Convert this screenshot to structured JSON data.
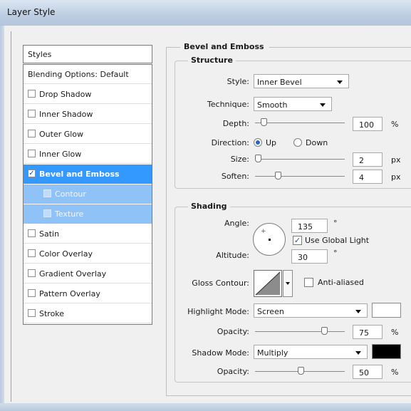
{
  "window": {
    "title": "Layer Style"
  },
  "styles_panel": {
    "header": "Styles",
    "items": [
      {
        "label": "Blending Options: Default",
        "checkbox": false,
        "checked": false
      },
      {
        "label": "Drop Shadow",
        "checkbox": true,
        "checked": false
      },
      {
        "label": "Inner Shadow",
        "checkbox": true,
        "checked": false
      },
      {
        "label": "Outer Glow",
        "checkbox": true,
        "checked": false
      },
      {
        "label": "Inner Glow",
        "checkbox": true,
        "checked": false
      },
      {
        "label": "Bevel and Emboss",
        "checkbox": true,
        "checked": true,
        "selected": true
      },
      {
        "label": "Contour",
        "checkbox": true,
        "checked": false,
        "sub": true
      },
      {
        "label": "Texture",
        "checkbox": true,
        "checked": false,
        "sub": true
      },
      {
        "label": "Satin",
        "checkbox": true,
        "checked": false
      },
      {
        "label": "Color Overlay",
        "checkbox": true,
        "checked": false
      },
      {
        "label": "Gradient Overlay",
        "checkbox": true,
        "checked": false
      },
      {
        "label": "Pattern Overlay",
        "checkbox": true,
        "checked": false
      },
      {
        "label": "Stroke",
        "checkbox": true,
        "checked": false
      }
    ]
  },
  "bevel": {
    "title": "Bevel and Emboss",
    "structure": {
      "title": "Structure",
      "style_label": "Style:",
      "style_value": "Inner Bevel",
      "technique_label": "Technique:",
      "technique_value": "Smooth",
      "depth_label": "Depth:",
      "depth_value": "100",
      "depth_unit": "%",
      "direction_label": "Direction:",
      "direction_up": "Up",
      "direction_down": "Down",
      "direction_selected": "Up",
      "size_label": "Size:",
      "size_value": "2",
      "size_unit": "px",
      "soften_label": "Soften:",
      "soften_value": "4",
      "soften_unit": "px"
    },
    "shading": {
      "title": "Shading",
      "angle_label": "Angle:",
      "angle_value": "135",
      "angle_unit": "°",
      "global_light_label": "Use Global Light",
      "global_light_checked": true,
      "altitude_label": "Altitude:",
      "altitude_value": "30",
      "altitude_unit": "°",
      "gloss_label": "Gloss Contour:",
      "antialiased_label": "Anti-aliased",
      "antialiased_checked": false,
      "highlight_mode_label": "Highlight Mode:",
      "highlight_mode_value": "Screen",
      "highlight_color": "#ffffff",
      "highlight_opacity_label": "Opacity:",
      "highlight_opacity_value": "75",
      "highlight_opacity_unit": "%",
      "shadow_mode_label": "Shadow Mode:",
      "shadow_mode_value": "Multiply",
      "shadow_color": "#000000",
      "shadow_opacity_label": "Opacity:",
      "shadow_opacity_value": "50",
      "shadow_opacity_unit": "%"
    }
  },
  "colors": {
    "selection": "#3399ff",
    "selection_sub": "#8fc3f7",
    "titlebar": "#bccde2"
  }
}
